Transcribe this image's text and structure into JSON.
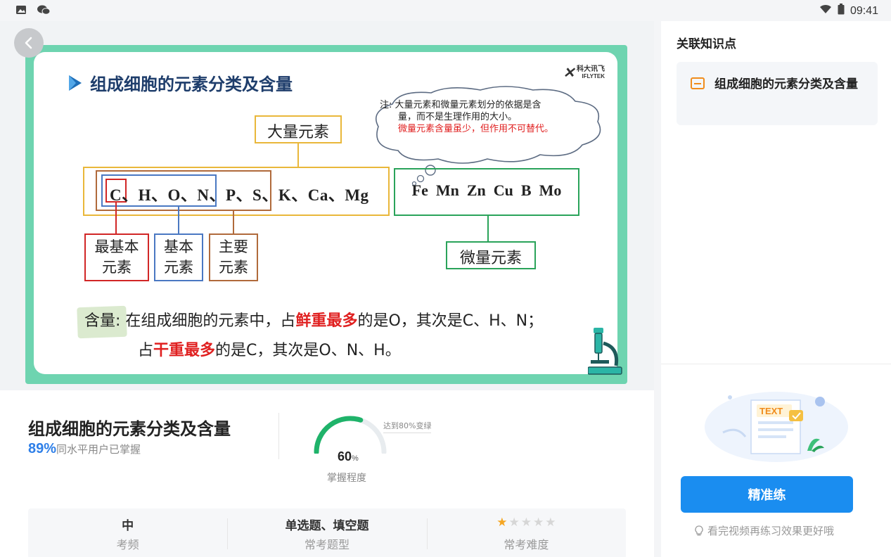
{
  "status_bar": {
    "time": "09:41"
  },
  "slide": {
    "title": "组成细胞的元素分类及含量",
    "logo_line1": "科大讯飞",
    "logo_line2": "IFLYTEK",
    "note_prefix": "注:",
    "note_line1": "大量元素和微量元素划分的依据是含",
    "note_line2": "量，而不是生理作用的大小。",
    "note_line3": "微量元素含量虽少，但作用不可替代。",
    "macro_label": "大量元素",
    "macro_elements": "C、H、O、N、P、S、K、Ca、Mg",
    "micro_elements": "Fe  Mn  Zn  Cu  B  Mo",
    "micro_label": "微量元素",
    "basic_most_l1": "最基本",
    "basic_most_l2": "元素",
    "basic_l1": "基本",
    "basic_l2": "元素",
    "main_l1": "主要",
    "main_l2": "元素",
    "content_label": "含量:",
    "content_line1_a": "在组成细胞的元素中，占",
    "content_line1_red": "鲜重最多",
    "content_line1_b": "的是O，其次是C、H、N；",
    "content_line2_a": "占",
    "content_line2_red": "干重最多",
    "content_line2_b": "的是C，其次是O、N、H。"
  },
  "knowledge": {
    "title": "组成细胞的元素分类及含量",
    "mastered_pct": "89%",
    "mastered_text": "同水平用户已掌握",
    "mastery_value": "60",
    "mastery_unit": "%",
    "mastery_fraction": 0.6,
    "mastery_label": "掌握程度",
    "mastery_hint": "达到80%变绿"
  },
  "stats": {
    "frequency_value": "中",
    "frequency_label": "考频",
    "types_value": "单选题、填空题",
    "types_label": "常考题型",
    "difficulty_rating": 1,
    "difficulty_max": 5,
    "difficulty_label": "常考难度"
  },
  "side_panel": {
    "title": "关联知识点",
    "card_text": "组成细胞的元素分类及含量",
    "illus_text": "TEXT",
    "practice_button": "精准练",
    "tip": "看完视频再练习效果更好哦"
  },
  "colors": {
    "accent_blue": "#1a8df0",
    "slide_green": "#6ed4b0",
    "gauge_green": "#1fb36a",
    "red_text": "#e02020",
    "star": "#f5a623",
    "card_icon": "#f08c1c"
  }
}
